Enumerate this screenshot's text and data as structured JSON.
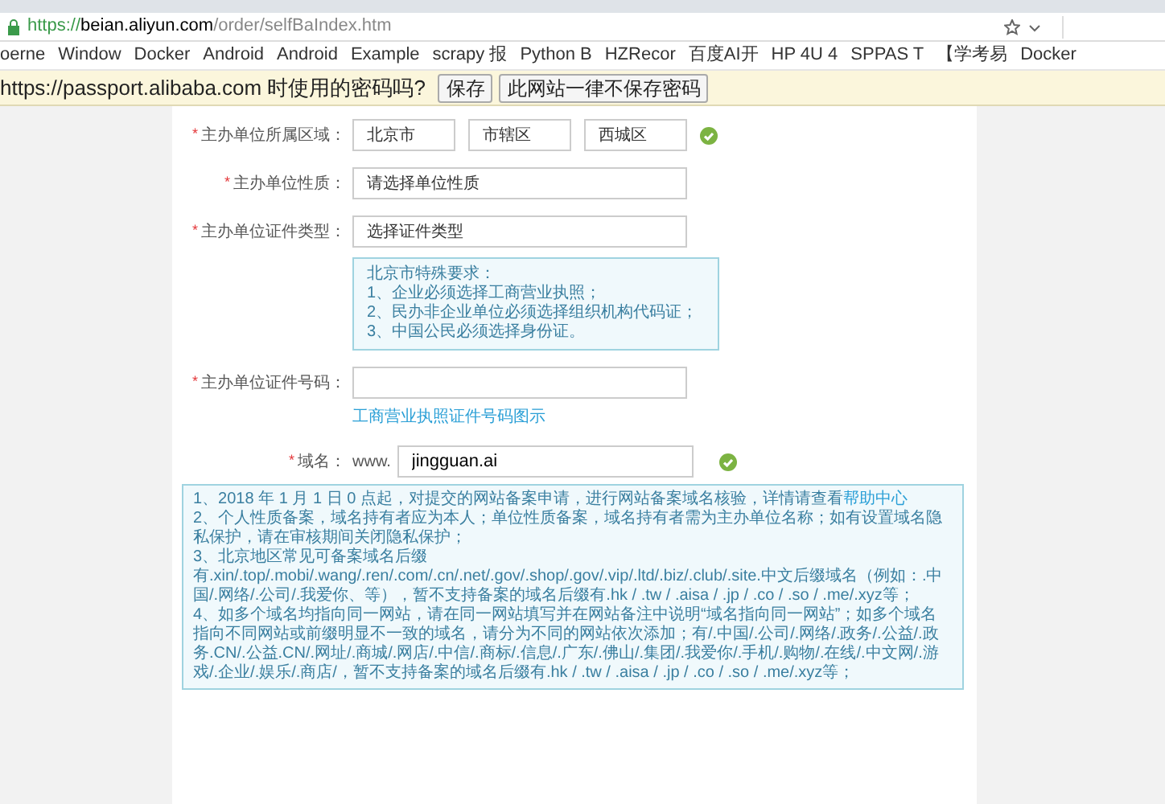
{
  "address_bar": {
    "scheme": "https://",
    "host": "beian.aliyun.com",
    "path": "/order/selfBaIndex.htm"
  },
  "bookmarks": [
    "oerne",
    "Window",
    "Docker",
    "Android",
    "Android",
    "Example",
    "scrapy 报",
    "Python B",
    "HZRecor",
    "百度AI开",
    "HP 4U 4",
    "SPPAS T",
    "【学考易",
    "Docker"
  ],
  "password_bar": {
    "message": "https://passport.alibaba.com 时使用的密码吗?",
    "buttons": [
      "保存",
      "此网站一律不保存密码"
    ]
  },
  "form": [
    {
      "kind": "selects",
      "required_mark": "*",
      "label": "主办单位所属区域：",
      "selects": [
        "北京市",
        "市辖区",
        "西城区"
      ],
      "valid": true
    },
    {
      "kind": "select",
      "required_mark": "*",
      "label": "主办单位性质：",
      "value": "请选择单位性质"
    },
    {
      "kind": "select",
      "required_mark": "*",
      "label": "主办单位证件类型：",
      "value": "选择证件类型",
      "hint": {
        "title": "北京市特殊要求：",
        "lines": [
          "1、企业必须选择工商营业执照；",
          "2、民办非企业单位必须选择组织机构代码证；",
          "3、中国公民必须选择身份证。"
        ]
      }
    },
    {
      "kind": "input",
      "required_mark": "*",
      "label": "主办单位证件号码：",
      "link": "工商营业执照证件号码图示"
    },
    {
      "kind": "domain",
      "required_mark": "*",
      "label": "域名：",
      "prefix": "www.",
      "value": "jingguan.ai",
      "valid": true,
      "notes": [
        {
          "text": "1、2018 年 1 月 1 日 0 点起，对提交的网站备案申请，进行网站备案域名核验，详情请查看",
          "link": "帮助中心"
        },
        {
          "text": "2、个人性质备案，域名持有者应为本人；单位性质备案，域名持有者需为主办单位名称；如有设置域名隐私保护，请在审核期间关闭隐私保护；"
        },
        {
          "text": "3、北京地区常见可备案域名后缀有.xin/.top/.mobi/.wang/.ren/.com/.cn/.net/.gov/.shop/.gov/.vip/.ltd/.biz/.club/.site.中文后缀域名（例如：.中国/.网络/.公司/.我爱你、等），暂不支持备案的域名后缀有.hk / .tw / .aisa / .jp / .co / .so / .me/.xyz等；"
        },
        {
          "text": "4、如多个域名均指向同一网站，请在同一网站填写并在网站备注中说明“域名指向同一网站”；如多个域名指向不同网站或前缀明显不一致的域名，请分为不同的网站依次添加；有/.中国/.公司/.网络/.政务/.公益/.政务.CN/.公益.CN/.网址/.商城/.网店/.中信/.商标/.信息/.广东/.佛山/.集团/.我爱你/.手机/.购物/.在线/.中文网/.游戏/.企业/.娱乐/.商店/，暂不支持备案的域名后缀有.hk / .tw / .aisa / .jp / .co / .so / .me/.xyz等；"
        }
      ]
    }
  ]
}
